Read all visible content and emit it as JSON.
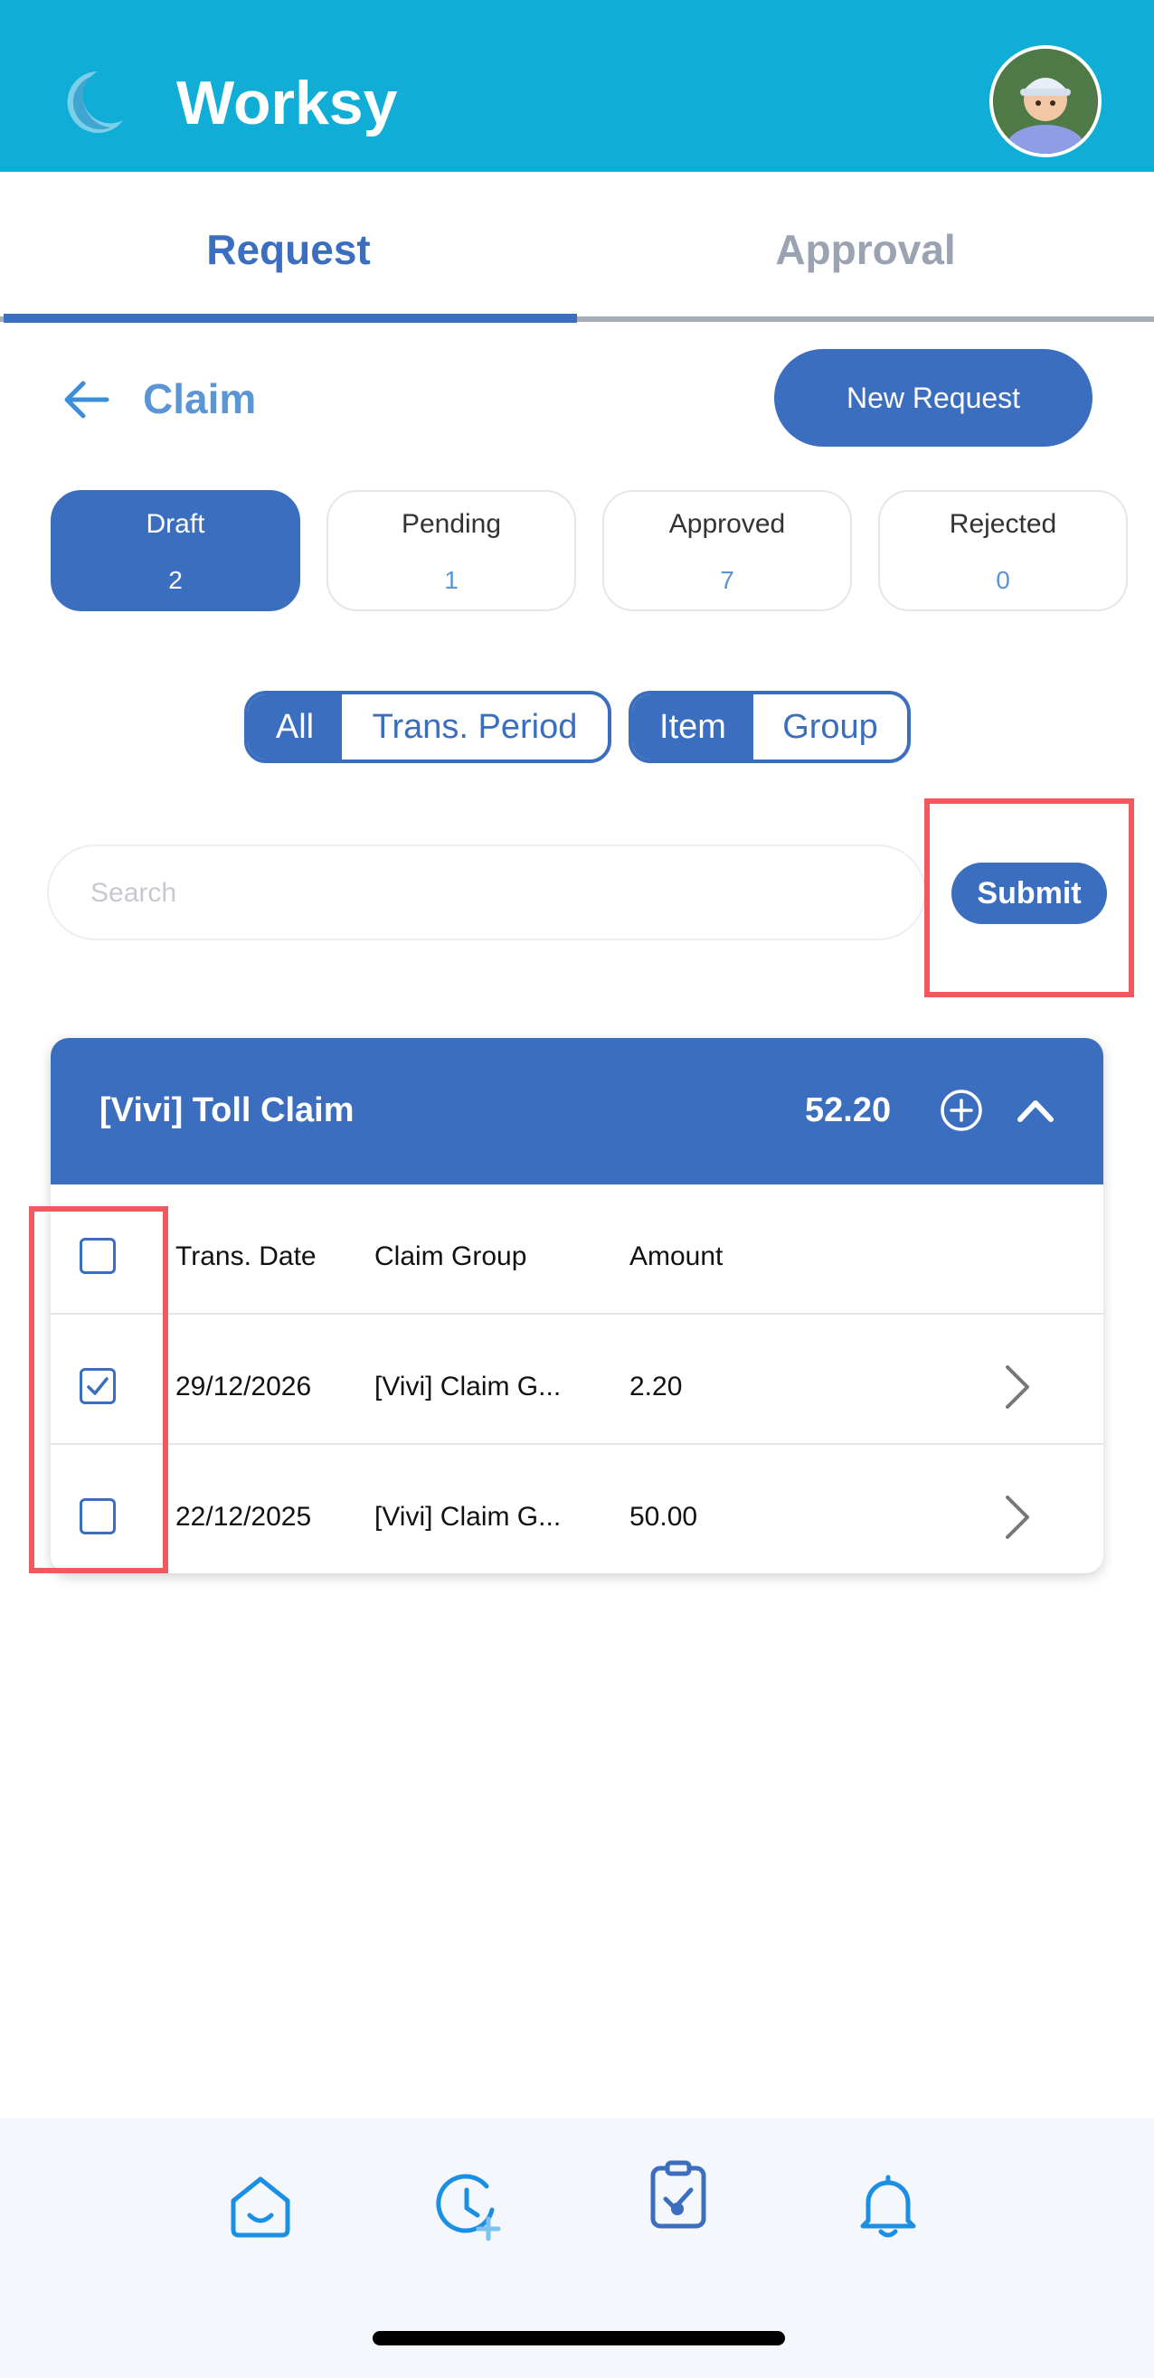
{
  "app": {
    "title": "Worksy"
  },
  "tabs": [
    {
      "label": "Request",
      "active": true
    },
    {
      "label": "Approval",
      "active": false
    }
  ],
  "page": {
    "title": "Claim",
    "new_request_label": "New Request"
  },
  "status_cards": [
    {
      "label": "Draft",
      "count": "2",
      "active": true
    },
    {
      "label": "Pending",
      "count": "1",
      "active": false
    },
    {
      "label": "Approved",
      "count": "7",
      "active": false
    },
    {
      "label": "Rejected",
      "count": "0",
      "active": false
    }
  ],
  "filters": {
    "period": {
      "options": [
        "All",
        "Trans. Period"
      ],
      "selected": "All"
    },
    "view": {
      "options": [
        "Item",
        "Group"
      ],
      "selected": "Item"
    }
  },
  "search": {
    "placeholder": "Search",
    "value": ""
  },
  "submit_label": "Submit",
  "claim_group": {
    "title": "[Vivi] Toll Claim",
    "total": "52.20",
    "columns": [
      "Trans. Date",
      "Claim Group",
      "Amount"
    ],
    "rows": [
      {
        "checked": true,
        "date": "29/12/2026",
        "group": "[Vivi] Claim G...",
        "amount": "2.20"
      },
      {
        "checked": false,
        "date": "22/12/2025",
        "group": "[Vivi] Claim G...",
        "amount": "50.00"
      }
    ],
    "select_all_checked": false
  },
  "bottom_nav": [
    {
      "icon": "home-icon"
    },
    {
      "icon": "clock-add-icon"
    },
    {
      "icon": "clipboard-check-icon",
      "active": true
    },
    {
      "icon": "bell-icon"
    }
  ],
  "colors": {
    "header": "#10ADD6",
    "primary": "#3B6EBF",
    "highlight": "#F05A5E"
  }
}
